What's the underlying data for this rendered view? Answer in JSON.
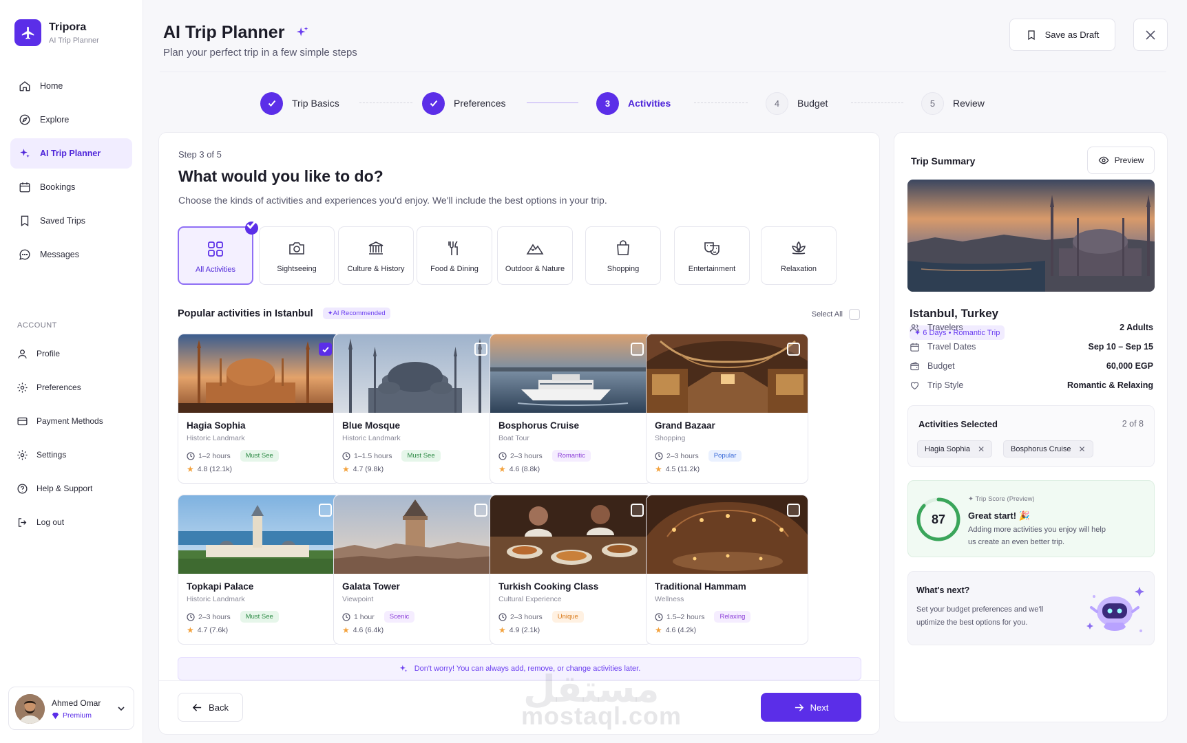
{
  "app": {
    "name": "Tripora",
    "subtitle": "AI Trip Planner"
  },
  "nav": [
    {
      "label": "Home",
      "icon": "home-icon"
    },
    {
      "label": "Explore",
      "icon": "compass-icon"
    },
    {
      "label": "AI Trip Planner",
      "icon": "sparkle-icon",
      "active": true
    },
    {
      "label": "Bookings",
      "icon": "calendar-icon"
    },
    {
      "label": "Saved Trips",
      "icon": "bookmark-icon"
    },
    {
      "label": "Messages",
      "icon": "chat-icon"
    }
  ],
  "account": {
    "heading": "ACCOUNT",
    "items": [
      {
        "label": "Profile",
        "icon": "user-icon"
      },
      {
        "label": "Preferences",
        "icon": "gear-icon"
      },
      {
        "label": "Payment Methods",
        "icon": "card-icon"
      },
      {
        "label": "Settings",
        "icon": "gear-icon"
      },
      {
        "label": "Help & Support",
        "icon": "help-icon"
      },
      {
        "label": "Log out",
        "icon": "logout-icon"
      }
    ]
  },
  "user": {
    "name": "Ahmed Omar",
    "plan": "Premium"
  },
  "header": {
    "title": "AI Trip Planner",
    "subtitle": "Plan your perfect trip in a few simple steps",
    "save_draft": "Save as Draft"
  },
  "steps": [
    {
      "num": "1",
      "label": "Trip Basics",
      "state": "done"
    },
    {
      "num": "2",
      "label": "Preferences",
      "state": "done"
    },
    {
      "num": "3",
      "label": "Activities",
      "state": "current"
    },
    {
      "num": "4",
      "label": "Budget",
      "state": "todo"
    },
    {
      "num": "5",
      "label": "Review",
      "state": "todo"
    }
  ],
  "main": {
    "step_of": "Step 3 of 5",
    "question": "What would you like to do?",
    "question_sub": "Choose the kinds of activities and experiences you'd enjoy. We'll include the best options in your trip.",
    "categories": [
      {
        "label": "All Activities",
        "icon": "grid-icon",
        "selected": true
      },
      {
        "label": "Sightseeing",
        "icon": "camera-icon"
      },
      {
        "label": "Culture & History",
        "icon": "museum-icon"
      },
      {
        "label": "Food & Dining",
        "icon": "fork-knife-icon"
      },
      {
        "label": "Outdoor & Nature",
        "icon": "mountain-icon"
      },
      {
        "label": "Shopping",
        "icon": "shopping-bag-icon"
      },
      {
        "label": "Entertainment",
        "icon": "theater-masks-icon"
      },
      {
        "label": "Relaxation",
        "icon": "lotus-icon"
      }
    ],
    "popular_title": "Popular activities in Istanbul",
    "ai_badge": "✦AI Recommended",
    "select_all": "Select All",
    "activities": [
      {
        "title": "Hagia Sophia",
        "type": "Historic Landmark",
        "duration": "1–2 hours",
        "tag": "Must See",
        "tag_color": "green",
        "rating": "4.8 (12.1k)",
        "checked": true
      },
      {
        "title": "Blue Mosque",
        "type": "Historic Landmark",
        "duration": "1–1.5 hours",
        "tag": "Must See",
        "tag_color": "green",
        "rating": "4.7 (9.8k)",
        "checked": false
      },
      {
        "title": "Bosphorus Cruise",
        "type": "Boat Tour",
        "duration": "2–3 hours",
        "tag": "Romantic",
        "tag_color": "pink",
        "rating": "4.6 (8.8k)",
        "checked": false
      },
      {
        "title": "Grand Bazaar",
        "type": "Shopping",
        "duration": "2–3 hours",
        "tag": "Popular",
        "tag_color": "blue",
        "rating": "4.5 (11.2k)",
        "checked": false
      },
      {
        "title": "Topkapi Palace",
        "type": "Historic Landmark",
        "duration": "2–3 hours",
        "tag": "Must See",
        "tag_color": "green",
        "rating": "4.7 (7.6k)",
        "checked": false
      },
      {
        "title": "Galata Tower",
        "type": "Viewpoint",
        "duration": "1 hour",
        "tag": "Scenic",
        "tag_color": "pink",
        "rating": "4.6 (6.4k)",
        "checked": false
      },
      {
        "title": "Turkish Cooking Class",
        "type": "Cultural Experience",
        "duration": "2–3 hours",
        "tag": "Unique",
        "tag_color": "orange",
        "rating": "4.9 (2.1k)",
        "checked": false
      },
      {
        "title": "Traditional Hammam",
        "type": "Wellness",
        "duration": "1.5–2 hours",
        "tag": "Relaxing",
        "tag_color": "pink",
        "rating": "4.6 (4.2k)",
        "checked": false
      }
    ],
    "info": "Don't worry! You can always add, remove, or change activities later.",
    "back": "Back",
    "next": "Next"
  },
  "watermark": {
    "arabic": "مستقل",
    "latin": "mostaql.com"
  },
  "summary": {
    "title": "Trip Summary",
    "preview": "Preview",
    "city": "Istanbul, Turkey",
    "badge": "✦ 6 Days • Romantic Trip",
    "rows": [
      {
        "label": "Travelers",
        "value": "2 Adults",
        "icon": "users-icon"
      },
      {
        "label": "Travel Dates",
        "value": "Sep 10 – Sep 15",
        "icon": "calendar-icon"
      },
      {
        "label": "Budget",
        "value": "60,000 EGP",
        "icon": "wallet-icon"
      },
      {
        "label": "Trip Style",
        "value": "Romantic & Relaxing",
        "icon": "heart-icon"
      }
    ],
    "activities_title": "Activities Selected",
    "activities_count": "2 of 8",
    "chips": [
      "Hagia Sophia",
      "Bosphorus Cruise"
    ],
    "score_label": "Trip Score (Preview)",
    "score": "87",
    "score_fraction": 0.87,
    "score_heading": "Great start! 🎉",
    "score_text": "Adding more activities you enjoy will help us create an even better trip.",
    "next_title": "What's next?",
    "next_text": "Set your budget preferences and we'll uptimize the best options for you."
  },
  "colors": {
    "accent": "#5b2ee8",
    "success": "#3aa55a",
    "tag_green": "#2d8a45",
    "tag_pink": "#8b3dd8",
    "tag_blue": "#3a6ad8",
    "tag_orange": "#d97a1a"
  }
}
